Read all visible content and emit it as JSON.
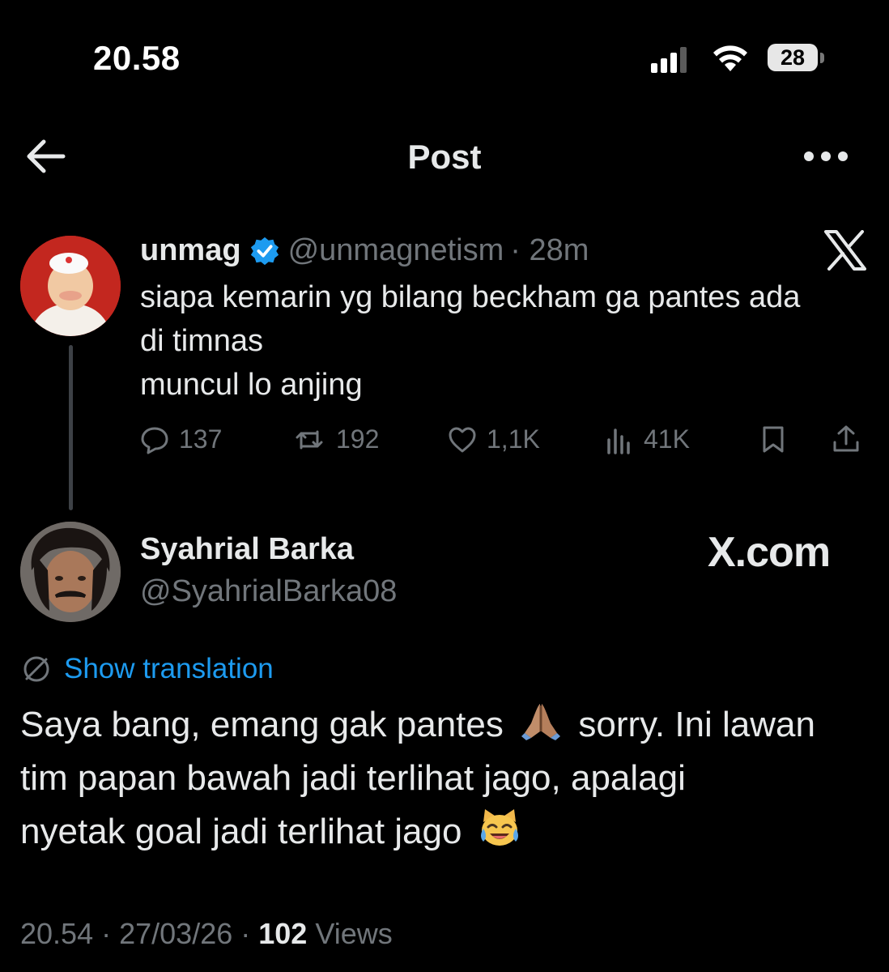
{
  "status_bar": {
    "time": "20.58",
    "battery": "28"
  },
  "header": {
    "title": "Post"
  },
  "original_post": {
    "name": "unmag",
    "handle": "@unmagnetism",
    "age": "· 28m",
    "lines": [
      "siapa kemarin yg bilang beckham ga pantes ada",
      "di timnas",
      "muncul lo anjing"
    ],
    "replies": "137",
    "reposts": "192",
    "likes": "1,1K",
    "views": "41K"
  },
  "reply": {
    "name": "Syahrial Barka",
    "handle": "@SyahrialBarka08",
    "watermark": "X.com",
    "translate_label": "Show translation",
    "line1_a": "Saya bang, emang gak pantes",
    "line1_b": "sorry. Ini lawan",
    "line2": "tim papan bawah jadi terlihat jago, apalagi",
    "line3": "nyetak goal jadi terlihat jago",
    "emoji_1": "folded-hands",
    "emoji_2": "cat-tears-of-joy",
    "time": "20.54",
    "date": "27/03/26",
    "views_count": "102",
    "views_label": "Views"
  },
  "colors": {
    "accent": "#1d9bf0",
    "muted": "#71767b",
    "text": "#e7e9ea",
    "verified": "#1d9bf0"
  }
}
